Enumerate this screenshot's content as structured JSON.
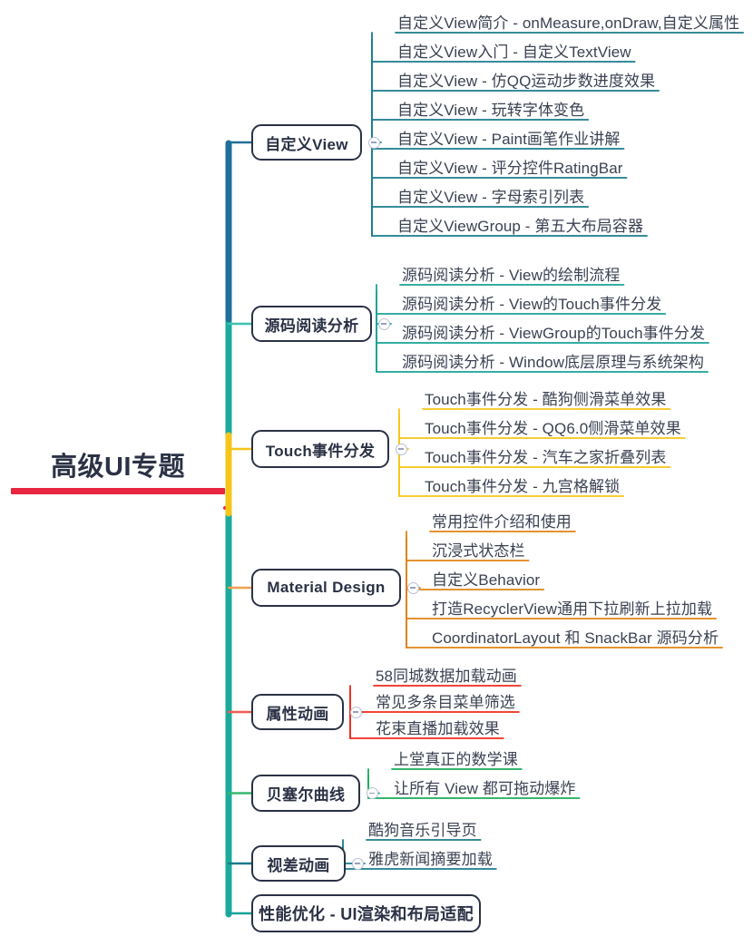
{
  "document": {
    "type": "mindmap",
    "title": "高级UI专题",
    "background": "#ffffff"
  },
  "root": {
    "label": "高级UI专题",
    "underline_color": "#e8253f",
    "text_color": "#2b3245"
  },
  "palette": {
    "node_border": "#2b3245",
    "node_text": "#2b3245",
    "leaf_text": "#3b4252",
    "spine": "#1aab9c",
    "toggle_ring": "#b9c0d4",
    "toggle_dash": "#98a0ba"
  },
  "toggle": {
    "icon": "minus-circle-icon",
    "state": "expanded"
  },
  "branches": [
    {
      "label": "自定义View",
      "color": "#1a7b8c",
      "stem_color": "#1f6f99",
      "leaves": [
        "自定义View简介 - onMeasure,onDraw,自定义属性",
        "自定义View入门 - 自定义TextView",
        "自定义View - 仿QQ运动步数进度效果",
        "自定义View - 玩转字体变色",
        "自定义View - Paint画笔作业讲解",
        "自定义View - 评分控件RatingBar",
        "自定义View - 字母索引列表",
        "自定义ViewGroup - 第五大布局容器"
      ]
    },
    {
      "label": "源码阅读分析",
      "color": "#17a398",
      "stem_color": "#3fc1b0",
      "leaves": [
        "源码阅读分析 - View的绘制流程",
        "源码阅读分析 - View的Touch事件分发",
        "源码阅读分析 - ViewGroup的Touch事件分发",
        "源码阅读分析 - Window底层原理与系统架构"
      ]
    },
    {
      "label": "Touch事件分发",
      "color": "#f5c518",
      "stem_color": "#f5c518",
      "leaves": [
        "Touch事件分发 - 酷狗侧滑菜单效果",
        "Touch事件分发 - QQ6.0侧滑菜单效果",
        "Touch事件分发 - 汽车之家折叠列表",
        "Touch事件分发 - 九宫格解锁"
      ]
    },
    {
      "label": "Material Design",
      "color": "#e08214",
      "stem_color": "#f0a050",
      "leaves": [
        "常用控件介绍和使用",
        "沉浸式状态栏",
        "自定义Behavior",
        "打造RecyclerView通用下拉刷新上拉加载",
        "CoordinatorLayout 和 SnackBar 源码分析"
      ]
    },
    {
      "label": "属性动画",
      "color": "#ef2b1e",
      "stem_color": "#ef5c50",
      "leaves": [
        "58同城数据加载动画",
        "常见多条目菜单筛选",
        "花束直播加载效果"
      ]
    },
    {
      "label": "贝塞尔曲线",
      "color": "#1aab5c",
      "stem_color": "#35b870",
      "leaves": [
        "上堂真正的数学课",
        "让所有 View 都可拖动爆炸"
      ]
    },
    {
      "label": "视差动画",
      "color": "#1a7b8c",
      "stem_color": "#1a7b8c",
      "leaves": [
        "酷狗音乐引导页",
        "雅虎新闻摘要加载"
      ]
    },
    {
      "label": "性能优化 - UI渲染和布局适配",
      "color": "#17a398",
      "stem_color": "#17a398",
      "leaves": []
    }
  ]
}
